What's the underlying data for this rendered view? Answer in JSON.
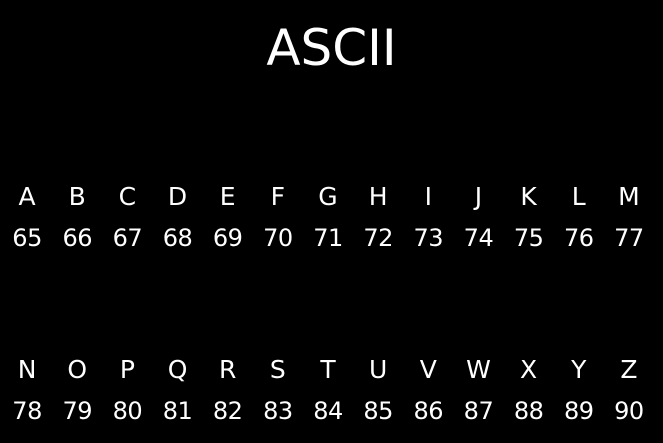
{
  "title": "ASCII",
  "rows": [
    {
      "letters": [
        "A",
        "B",
        "C",
        "D",
        "E",
        "F",
        "G",
        "H",
        "I",
        "J",
        "K",
        "L",
        "M"
      ],
      "codes": [
        "65",
        "66",
        "67",
        "68",
        "69",
        "70",
        "71",
        "72",
        "73",
        "74",
        "75",
        "76",
        "77"
      ]
    },
    {
      "letters": [
        "N",
        "O",
        "P",
        "Q",
        "R",
        "S",
        "T",
        "U",
        "V",
        "W",
        "X",
        "Y",
        "Z"
      ],
      "codes": [
        "78",
        "79",
        "80",
        "81",
        "82",
        "83",
        "84",
        "85",
        "86",
        "87",
        "88",
        "89",
        "90"
      ]
    }
  ],
  "colors": {
    "background": "#000000",
    "text": "#ffffff"
  }
}
